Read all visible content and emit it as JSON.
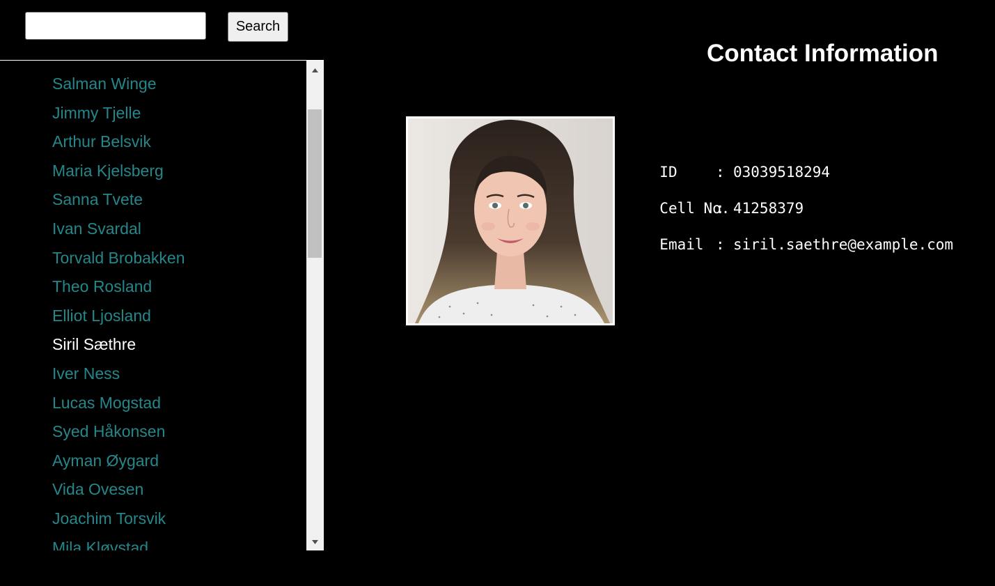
{
  "search": {
    "value": "",
    "placeholder": "",
    "button_label": "Search"
  },
  "contacts": [
    {
      "name": "Salman Winge",
      "selected": false
    },
    {
      "name": "Jimmy Tjelle",
      "selected": false
    },
    {
      "name": "Arthur Belsvik",
      "selected": false
    },
    {
      "name": "Maria Kjelsberg",
      "selected": false
    },
    {
      "name": "Sanna Tvete",
      "selected": false
    },
    {
      "name": "Ivan Svardal",
      "selected": false
    },
    {
      "name": "Torvald Brobakken",
      "selected": false
    },
    {
      "name": "Theo Rosland",
      "selected": false
    },
    {
      "name": "Elliot Ljosland",
      "selected": false
    },
    {
      "name": "Siril Sæthre",
      "selected": true
    },
    {
      "name": "Iver Ness",
      "selected": false
    },
    {
      "name": "Lucas Mogstad",
      "selected": false
    },
    {
      "name": "Syed Håkonsen",
      "selected": false
    },
    {
      "name": "Ayman Øygard",
      "selected": false
    },
    {
      "name": "Vida Ovesen",
      "selected": false
    },
    {
      "name": "Joachim Torsvik",
      "selected": false
    },
    {
      "name": "Mila Kløvstad",
      "selected": false
    }
  ],
  "detail": {
    "title": "Contact Information",
    "id_label": "ID",
    "id_value": "03039518294",
    "cell_label": "Cell No.",
    "cell_value": "41258379",
    "email_label": "Email",
    "email_value": "siril.saethre@example.com",
    "separator": ":"
  },
  "colors": {
    "background": "#000000",
    "link": "#25878a",
    "selected": "#ffffff"
  },
  "icons": {
    "scroll_up": "triangle-up-icon",
    "scroll_down": "triangle-down-icon"
  }
}
